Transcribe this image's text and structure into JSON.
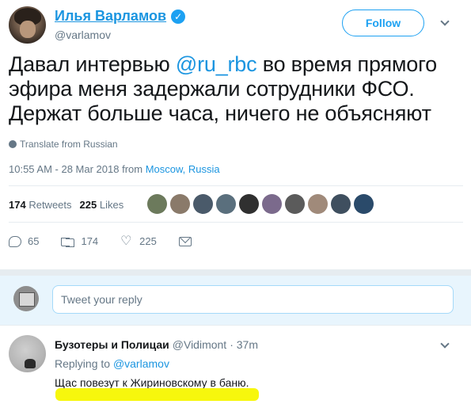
{
  "tweet": {
    "author_name": "Илья Варламов",
    "author_handle": "@varlamov",
    "follow_label": "Follow",
    "verified_glyph": "✓",
    "text_part1": "Давал интервью ",
    "text_mention": "@ru_rbc",
    "text_part2": " во время прямого эфира меня задержали сотрудники ФСО. Держат больше часа, ничего не объясняют",
    "translate_label": "Translate from Russian",
    "timestamp": "10:55 AM - 28 Mar 2018 from ",
    "location": "Moscow, Russia",
    "retweets_count": "174",
    "retweets_label": "Retweets",
    "likes_count": "225",
    "likes_label": "Likes",
    "likers": [
      "#6c7a5c",
      "#8a7a6a",
      "#4a5a6a",
      "#5a6f7d",
      "#303030",
      "#7b6a8c",
      "#5b5b5b",
      "#a08a7a",
      "#3f4f5f",
      "#2a4a6a"
    ],
    "actions": {
      "reply_count": "65",
      "retweet_count": "174",
      "like_count": "225"
    },
    "accent_color": "#1da1f2"
  },
  "reply_box": {
    "placeholder": "Tweet your reply"
  },
  "reply_tweet": {
    "author_name": "Бузотеры и Полицаи",
    "author_handle": "@Vidimont",
    "time": "· 37m",
    "replying_prefix": "Replying to ",
    "replying_to": "@varlamov",
    "text": "Щас повезут к Жириновскому в баню."
  }
}
